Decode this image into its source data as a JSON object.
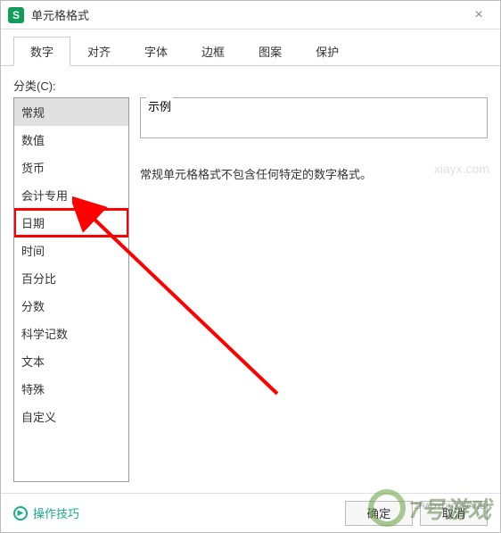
{
  "title": "单元格格式",
  "close": "×",
  "tabs": [
    {
      "label": "数字",
      "active": true
    },
    {
      "label": "对齐",
      "active": false
    },
    {
      "label": "字体",
      "active": false
    },
    {
      "label": "边框",
      "active": false
    },
    {
      "label": "图案",
      "active": false
    },
    {
      "label": "保护",
      "active": false
    }
  ],
  "category_label": "分类(C):",
  "categories": [
    {
      "label": "常规",
      "selected": true,
      "highlight": false
    },
    {
      "label": "数值",
      "selected": false,
      "highlight": false
    },
    {
      "label": "货币",
      "selected": false,
      "highlight": false
    },
    {
      "label": "会计专用",
      "selected": false,
      "highlight": false
    },
    {
      "label": "日期",
      "selected": false,
      "highlight": true
    },
    {
      "label": "时间",
      "selected": false,
      "highlight": false
    },
    {
      "label": "百分比",
      "selected": false,
      "highlight": false
    },
    {
      "label": "分数",
      "selected": false,
      "highlight": false
    },
    {
      "label": "科学记数",
      "selected": false,
      "highlight": false
    },
    {
      "label": "文本",
      "selected": false,
      "highlight": false
    },
    {
      "label": "特殊",
      "selected": false,
      "highlight": false
    },
    {
      "label": "自定义",
      "selected": false,
      "highlight": false
    }
  ],
  "example_label": "示例",
  "description": "常规单元格格式不包含任何特定的数字格式。",
  "tips_link": "操作技巧",
  "buttons": {
    "ok": "确定",
    "cancel": "取消"
  },
  "watermarks": {
    "top": "xiayx.com",
    "bottom": "7号游戏",
    "sub": "ZHAOYOUXIWANG"
  }
}
